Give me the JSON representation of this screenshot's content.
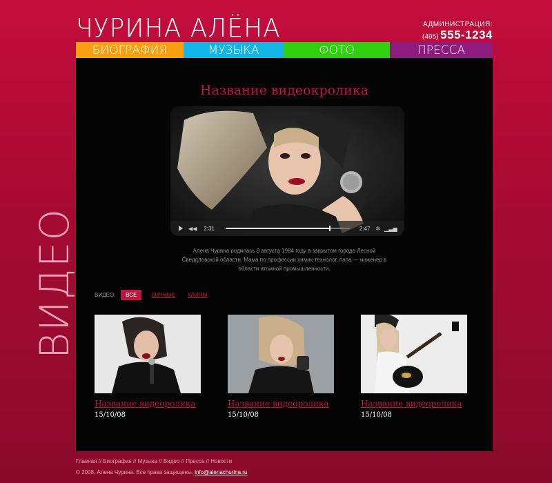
{
  "header": {
    "logo_text": "ЧУРИНА АЛЁНА",
    "admin_label": "АДМИНИСТРАЦИЯ:",
    "phone_code": "(495)",
    "phone_number": "555-1234"
  },
  "nav": {
    "items": [
      {
        "label": "БИОГРАФИЯ",
        "color": "#f6a012"
      },
      {
        "label": "МУЗЫКА",
        "color": "#13b5e6"
      },
      {
        "label": "ФОТО",
        "color": "#2fd10f"
      },
      {
        "label": "ПРЕССА",
        "color": "#8f1a7e"
      }
    ]
  },
  "side_title": "ВИДЕО",
  "video": {
    "title": "Название видеокролика",
    "elapsed": "2:31",
    "duration": "2:47",
    "progress": 0.84,
    "description": "Алена Чурина родилась 9 августа 1984 году в закрытом городе Лесной Свердловской области. Мама по профессии химик-технолог, папа — инженер в области атомной промышленности."
  },
  "filters": {
    "label": "ВИДЕО:",
    "all": "ВСЕ",
    "personal": "ЛИЧНЫЕ",
    "clips": "КЛИПЫ"
  },
  "videos": [
    {
      "title": "Название видеоролика",
      "date": "15/10/08"
    },
    {
      "title": "Название видеоролика",
      "date": "15/10/08"
    },
    {
      "title": "Название видеоролика",
      "date": "15/10/08"
    }
  ],
  "footer": {
    "links": [
      "Главная",
      "Биография",
      "Музыка",
      "Видео",
      "Пресса",
      "Новости"
    ],
    "separator": "//",
    "copyright": "© 2008, Алена Чурина. Все права защищены.",
    "email": "info@alenachurina.ru"
  },
  "colors": {
    "accent": "#c11340",
    "background": "#b50c37",
    "panel": "#050505"
  }
}
